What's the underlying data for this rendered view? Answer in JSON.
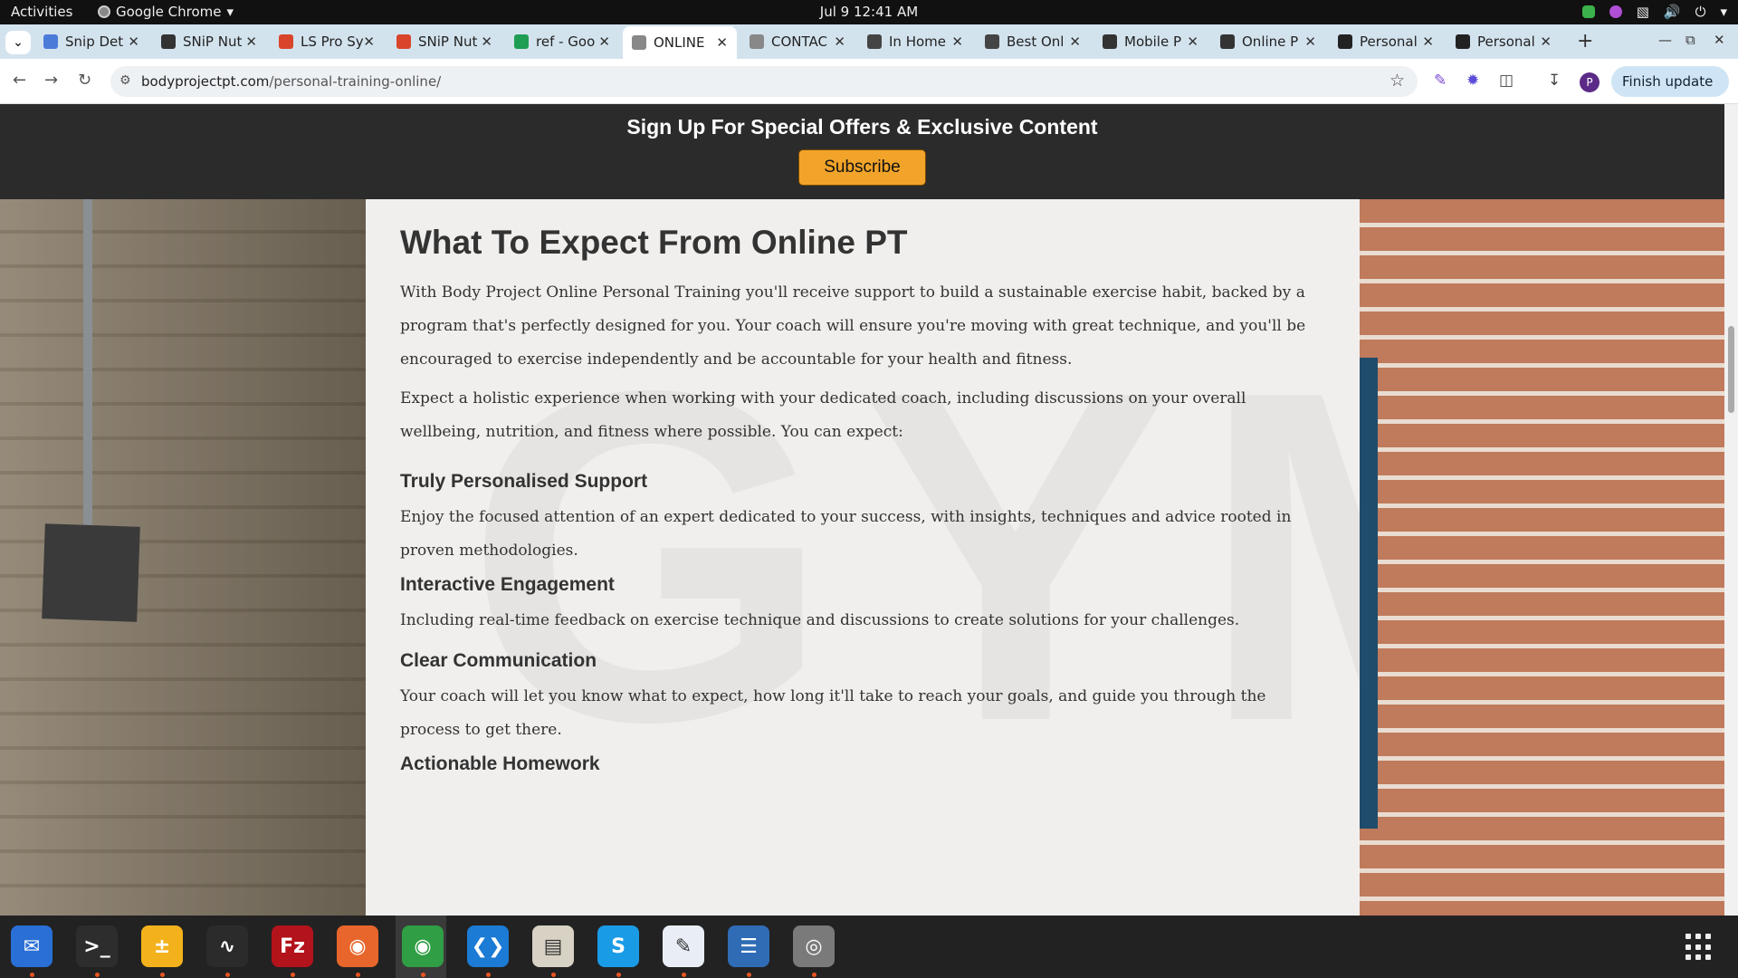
{
  "system": {
    "activities": "Activities",
    "app_name": "Google Chrome",
    "clock": "Jul 9  12:41 AM"
  },
  "tabs": [
    {
      "title": "Snip Det",
      "icon_color": "#4a7bd8",
      "icon": "doc-icon"
    },
    {
      "title": "SNiP Nut",
      "icon_color": "#333333",
      "icon": "snip-icon"
    },
    {
      "title": "LS Pro Sy",
      "icon_color": "#d9452b",
      "icon": "chrome-icon"
    },
    {
      "title": "SNiP Nut",
      "icon_color": "#d9452b",
      "icon": "chrome-icon"
    },
    {
      "title": "ref - Goo",
      "icon_color": "#1e9e52",
      "icon": "sheets-icon"
    },
    {
      "title": "ONLINE",
      "icon_color": "#888888",
      "icon": "site-icon",
      "active": true
    },
    {
      "title": "CONTAC",
      "icon_color": "#888888",
      "icon": "site-icon"
    },
    {
      "title": "In Home",
      "icon_color": "#444444",
      "icon": "globe-icon"
    },
    {
      "title": "Best Onl",
      "icon_color": "#444444",
      "icon": "globe-icon"
    },
    {
      "title": "Mobile P",
      "icon_color": "#333333",
      "icon": "arch-icon"
    },
    {
      "title": "Online P",
      "icon_color": "#333333",
      "icon": "arch-icon"
    },
    {
      "title": "Personal",
      "icon_color": "#222222",
      "icon": "fs-icon"
    },
    {
      "title": "Personal",
      "icon_color": "#222222",
      "icon": "fs-icon"
    }
  ],
  "omnibox": {
    "domain": "bodyprojectpt.com",
    "path": "/personal-training-online/"
  },
  "toolbar": {
    "profile_initial": "P",
    "finish_update": "Finish update"
  },
  "page": {
    "promo_title": "Sign Up For Special Offers & Exclusive Content",
    "subscribe_label": "Subscribe",
    "watermark": "GYM",
    "heading": "What To Expect From Online PT",
    "para1": "With Body Project Online Personal Training you'll receive support to build a sustainable exercise habit, backed by a program that's perfectly designed for you. Your coach will ensure you're moving with great technique, and you'll be encouraged to exercise independently and be accountable for your health and fitness.",
    "para2": "Expect a holistic experience when working with your dedicated coach, including discussions on your overall wellbeing, nutrition, and fitness where possible. You can expect:",
    "sections": [
      {
        "title": "Truly Personalised Support",
        "body": "Enjoy the focused attention of an expert dedicated to your success, with insights, techniques and advice rooted in proven methodologies."
      },
      {
        "title": "Interactive Engagement",
        "body": "Including real-time feedback on exercise technique and discussions to create solutions for your challenges."
      },
      {
        "title": "Clear Communication",
        "body": "Your coach will let you know what to expect, how long it'll take to reach your goals, and guide you through the process to get there."
      },
      {
        "title": "Actionable Homework",
        "body": ""
      }
    ]
  },
  "dock": [
    {
      "name": "thunderbird-icon",
      "color": "#2a6fd6"
    },
    {
      "name": "terminal-icon",
      "color": "#2d2d2d"
    },
    {
      "name": "calculator-icon",
      "color": "#f3b21c"
    },
    {
      "name": "system-monitor-icon",
      "color": "#2b2b2b"
    },
    {
      "name": "filezilla-icon",
      "color": "#b3131b"
    },
    {
      "name": "firefox-icon",
      "color": "#e8662b"
    },
    {
      "name": "chrome-icon",
      "color": "#2f9e44"
    },
    {
      "name": "vscode-icon",
      "color": "#1c7bd4"
    },
    {
      "name": "files-icon",
      "color": "#d8d2c4"
    },
    {
      "name": "skype-icon",
      "color": "#1a9be6"
    },
    {
      "name": "text-editor-icon",
      "color": "#e9eef6"
    },
    {
      "name": "document-viewer-icon",
      "color": "#2f6cb5"
    },
    {
      "name": "disks-icon",
      "color": "#7a7a7a"
    }
  ]
}
